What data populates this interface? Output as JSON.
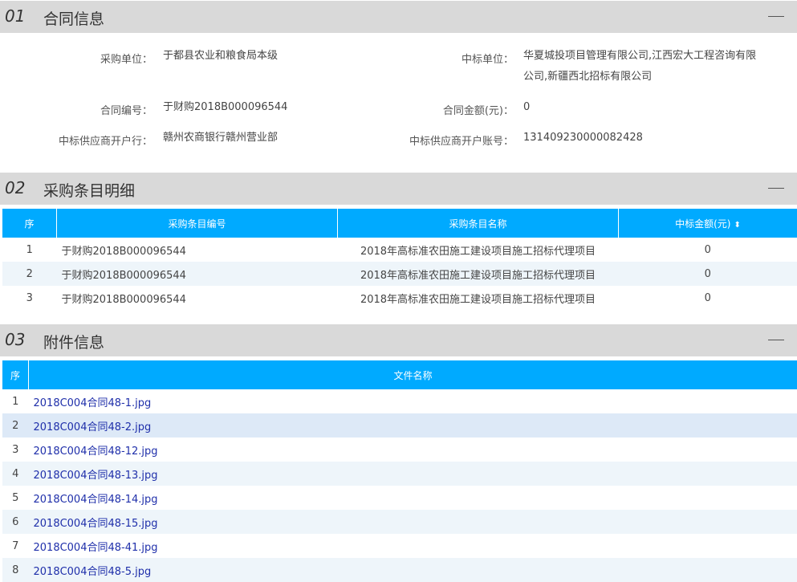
{
  "section1": {
    "num": "01",
    "title": "合同信息",
    "fields": {
      "buyer_label": "采购单位：",
      "buyer_value": "于都县农业和粮食局本级",
      "winner_label": "中标单位：",
      "winner_value_line1": "华夏城投项目管理有限公司,江西宏大工程咨询有限",
      "winner_value_line2": "公司,新疆西北招标有限公司",
      "contract_no_label": "合同编号：",
      "contract_no_value": "于财购2018B000096544",
      "amount_label": "合同金额(元)：",
      "amount_value": "0",
      "bank_label": "中标供应商开户行：",
      "bank_value": "赣州农商银行赣州营业部",
      "account_label": "中标供应商开户账号：",
      "account_value": "131409230000082428"
    }
  },
  "section2": {
    "num": "02",
    "title": "采购条目明细",
    "headers": [
      "序",
      "采购条目编号",
      "采购条目名称",
      "中标金额(元)"
    ],
    "sort_icon": "⬍",
    "rows": [
      {
        "idx": "1",
        "code": "于财购2018B000096544",
        "name": "2018年高标准农田施工建设项目施工招标代理项目",
        "amount": "0"
      },
      {
        "idx": "2",
        "code": "于财购2018B000096544",
        "name": "2018年高标准农田施工建设项目施工招标代理项目",
        "amount": "0"
      },
      {
        "idx": "3",
        "code": "于财购2018B000096544",
        "name": "2018年高标准农田施工建设项目施工招标代理项目",
        "amount": "0"
      }
    ]
  },
  "section3": {
    "num": "03",
    "title": "附件信息",
    "headers": [
      "序",
      "文件名称"
    ],
    "files": [
      {
        "idx": "1",
        "name": "2018C004合同48-1.jpg"
      },
      {
        "idx": "2",
        "name": "2018C004合同48-2.jpg"
      },
      {
        "idx": "3",
        "name": "2018C004合同48-12.jpg"
      },
      {
        "idx": "4",
        "name": "2018C004合同48-13.jpg"
      },
      {
        "idx": "5",
        "name": "2018C004合同48-14.jpg"
      },
      {
        "idx": "6",
        "name": "2018C004合同48-15.jpg"
      },
      {
        "idx": "7",
        "name": "2018C004合同48-41.jpg"
      },
      {
        "idx": "8",
        "name": "2018C004合同48-5.jpg"
      }
    ]
  },
  "colors": {
    "header_blue": "#00aaff",
    "section_gray": "#d9d9d9",
    "link_blue": "#1f2faa"
  },
  "icons": {
    "collapse": "minus-icon",
    "sort": "sort-icon"
  }
}
